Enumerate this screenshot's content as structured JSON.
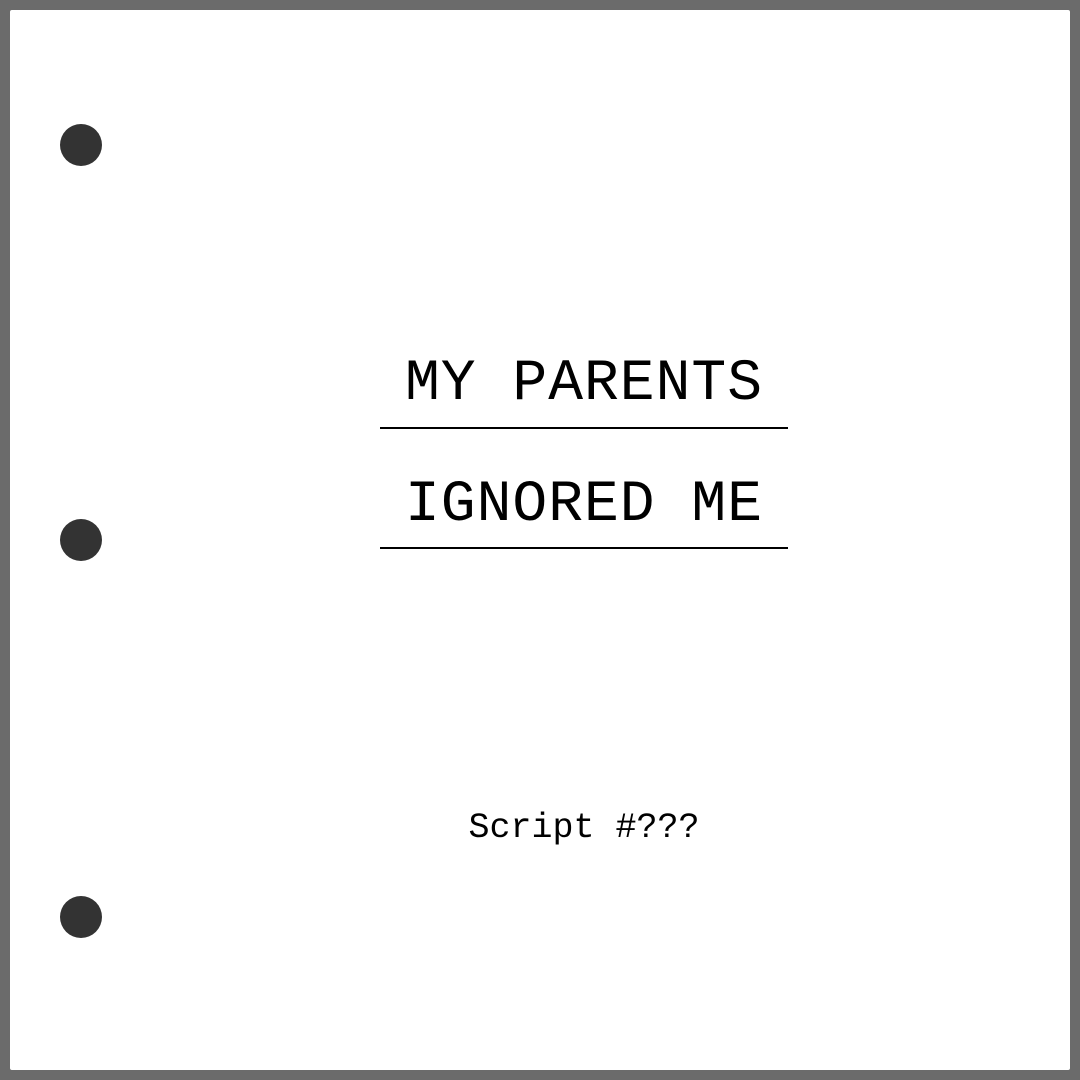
{
  "title": {
    "line1": "MY PARENTS",
    "line2": "IGNORED ME"
  },
  "subtitle": "Script #???",
  "colors": {
    "background_frame": "#6b6b6b",
    "page": "#ffffff",
    "binder_holes": "#333333",
    "text": "#000000"
  }
}
